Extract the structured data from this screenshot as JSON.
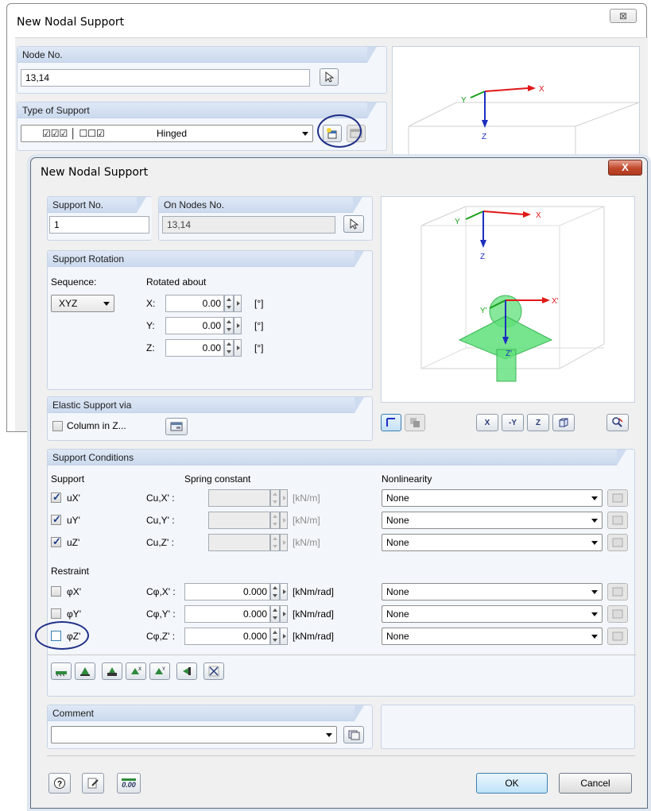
{
  "back": {
    "title": "New Nodal Support",
    "close_glyph": "⊠",
    "node_label": "Node No.",
    "node_value": "13,14",
    "type_label": "Type of Support",
    "type_value": "Hinged",
    "type_checks": "☑☑☑ │ ☐☐☑"
  },
  "front": {
    "title": "New Nodal Support",
    "close_glyph": "X",
    "support_no_label": "Support No.",
    "support_no_value": "1",
    "on_nodes_label": "On Nodes No.",
    "on_nodes_value": "13,14",
    "rotation": {
      "header": "Support Rotation",
      "sequence_label": "Sequence:",
      "sequence_value": "XYZ",
      "rotated_label": "Rotated about",
      "rows": [
        {
          "axis": "X:",
          "value": "0.00",
          "unit": "[°]"
        },
        {
          "axis": "Y:",
          "value": "0.00",
          "unit": "[°]"
        },
        {
          "axis": "Z:",
          "value": "0.00",
          "unit": "[°]"
        }
      ]
    },
    "elastic": {
      "header": "Elastic Support via",
      "column_label": "Column in Z..."
    },
    "conditions": {
      "header": "Support Conditions",
      "support_col": "Support",
      "spring_col": "Spring constant",
      "nonlin_col": "Nonlinearity",
      "restraint_label": "Restraint",
      "support_rows": [
        {
          "name": "uX'",
          "checked": true,
          "spring": "Cu,X' :",
          "value": "",
          "unit": "[kN/m]",
          "nonlin": "None"
        },
        {
          "name": "uY'",
          "checked": true,
          "spring": "Cu,Y' :",
          "value": "",
          "unit": "[kN/m]",
          "nonlin": "None"
        },
        {
          "name": "uZ'",
          "checked": true,
          "spring": "Cu,Z' :",
          "value": "",
          "unit": "[kN/m]",
          "nonlin": "None"
        }
      ],
      "restraint_rows": [
        {
          "name": "φX'",
          "checked": false,
          "spring": "Cφ,X' :",
          "value": "0.000",
          "unit": "[kNm/rad]",
          "nonlin": "None"
        },
        {
          "name": "φY'",
          "checked": false,
          "spring": "Cφ,Y' :",
          "value": "0.000",
          "unit": "[kNm/rad]",
          "nonlin": "None"
        },
        {
          "name": "φZ'",
          "checked": false,
          "spring": "Cφ,Z' :",
          "value": "0.000",
          "unit": "[kNm/rad]",
          "nonlin": "None"
        }
      ]
    },
    "comment": {
      "header": "Comment",
      "value": ""
    },
    "buttons": {
      "ok": "OK",
      "cancel": "Cancel",
      "calc": "0.00"
    },
    "preview_axes": {
      "x": "X",
      "y": "Y",
      "z": "Z",
      "x2": "X'",
      "y2": "Y'",
      "z2": "Z'"
    },
    "view_buttons": {
      "x": "X",
      "y": "-Y",
      "z": "Z"
    }
  },
  "colors": {
    "panel_header": "#cbdaee",
    "highlight_circle": "#1f2f88",
    "support_green": "#5fe07a",
    "axis_red": "#e01818",
    "axis_green": "#18a018",
    "axis_blue": "#1d2fbf"
  }
}
